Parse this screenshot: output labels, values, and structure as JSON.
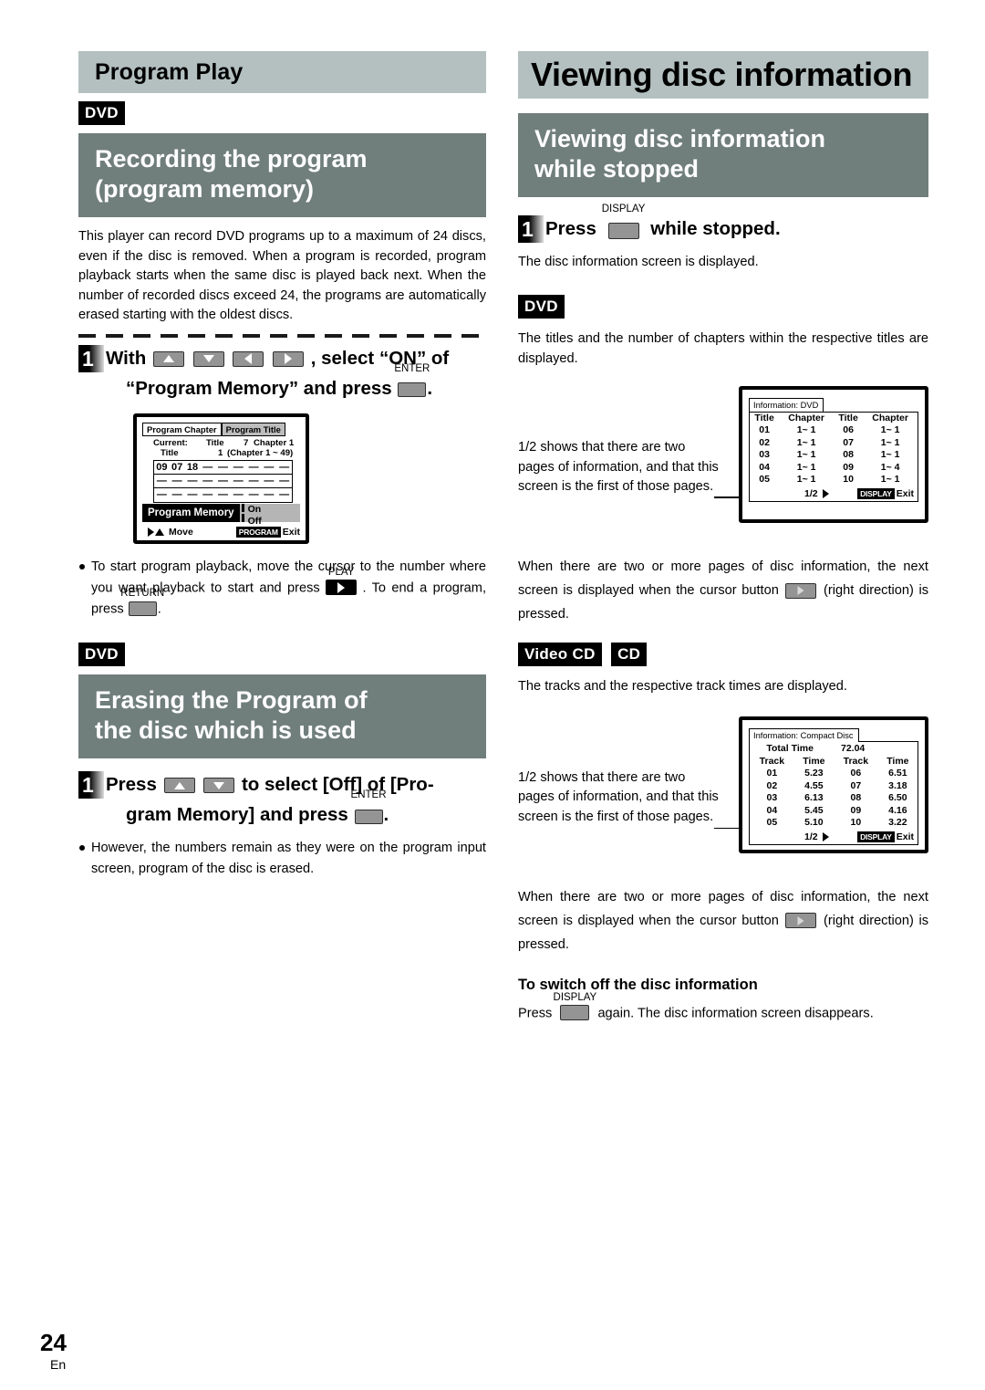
{
  "page": {
    "number": "24",
    "lang": "En"
  },
  "left": {
    "section_title": "Program Play",
    "chip_dvd_1": "DVD",
    "subhead_1_line1": "Recording the program",
    "subhead_1_line2": "(program memory)",
    "intro": "This player can record DVD programs up to a maximum of 24 discs, even if the disc is removed. When a program is recorded, program playback starts when the same disc is played back next. When the number of recorded discs exceed 24, the programs are automatically erased starting with the oldest discs.",
    "step1": {
      "num": "1",
      "t1": "With",
      "t2": ", select “ON” of",
      "t3": "“Program Memory” and press",
      "t4": ".",
      "enter_label": "ENTER"
    },
    "osd": {
      "tab_active": "Program Chapter",
      "tab_inactive": "Program Title",
      "current_label": "Current:",
      "title_label_1": "Title",
      "title_value_1": "7",
      "chapter_label": "Chapter 1",
      "title_label_2": "Title",
      "title_value_2": "1",
      "chapter_range": "(Chapter 1 ~ 49)",
      "rows": [
        [
          "09",
          "07",
          "18",
          "—",
          "—",
          "—",
          "—",
          "—",
          "—"
        ],
        [
          "—",
          "—",
          "—",
          "—",
          "—",
          "—",
          "—",
          "—",
          "—"
        ],
        [
          "—",
          "—",
          "—",
          "—",
          "—",
          "—",
          "—",
          "—",
          "—"
        ]
      ],
      "pm_label": "Program Memory",
      "pm_on": "On",
      "pm_off": "Off",
      "foot_move": "Move",
      "foot_tag": "PROGRAM",
      "foot_exit": "Exit"
    },
    "bullet1_a": "To start program playback, move the cursor to the number where you want playback to start and press",
    "bullet1_play_label": "PLAY",
    "bullet1_b": ". To end a program, press",
    "bullet1_return_label": "RETURN",
    "bullet1_c": ".",
    "chip_dvd_2": "DVD",
    "subhead_2_line1": "Erasing the Program of",
    "subhead_2_line2": "the disc which is used",
    "step2": {
      "num": "1",
      "t1": "Press",
      "t2": "to  select [Off] of [Pro-",
      "t3": "gram Memory] and press",
      "t4": ".",
      "enter_label": "ENTER"
    },
    "bullet2": "However, the numbers remain as they were on the program input screen, program of the disc is erased."
  },
  "right": {
    "page_title": "Viewing disc information",
    "subhead_line1": "Viewing disc information",
    "subhead_line2": "while stopped",
    "step1": {
      "num": "1",
      "t1": "Press",
      "t2": "while stopped.",
      "display_label": "DISPLAY"
    },
    "note1": "The disc information screen is displayed.",
    "chip_dvd": "DVD",
    "para_dvd": "The titles and the number of chapters within the respective titles are displayed.",
    "leader_note_1": "1/2 shows that there are two pages of information, and that this screen is the first of those pages.",
    "dvd_info": {
      "header": "Information: DVD",
      "cols": [
        "Title",
        "Chapter",
        "Title",
        "Chapter"
      ],
      "rows": [
        [
          "01",
          "1~ 1",
          "06",
          "1~ 1"
        ],
        [
          "02",
          "1~ 1",
          "07",
          "1~ 1"
        ],
        [
          "03",
          "1~ 1",
          "08",
          "1~ 1"
        ],
        [
          "04",
          "1~ 1",
          "09",
          "1~ 4"
        ],
        [
          "05",
          "1~ 1",
          "10",
          "1~ 1"
        ]
      ],
      "page_indicator": "1/2",
      "exit_tag": "DISPLAY",
      "exit_label": "Exit"
    },
    "para_next_1": "When there are two or more pages of disc information, the next screen is displayed when the cursor button",
    "para_next_1b": "(right direction) is pressed.",
    "chip_videocd": "Video CD",
    "chip_cd": "CD",
    "para_cd": "The tracks and the respective track times are displayed.",
    "leader_note_2": "1/2 shows that there are two pages of information, and that this screen is the first of those pages.",
    "cd_info": {
      "header": "Information: Compact Disc",
      "total_label": "Total Time",
      "total_value": "72.04",
      "cols": [
        "Track",
        "Time",
        "Track",
        "Time"
      ],
      "rows": [
        [
          "01",
          "5.23",
          "06",
          "6.51"
        ],
        [
          "02",
          "4.55",
          "07",
          "3.18"
        ],
        [
          "03",
          "6.13",
          "08",
          "6.50"
        ],
        [
          "04",
          "5.45",
          "09",
          "4.16"
        ],
        [
          "05",
          "5.10",
          "10",
          "3.22"
        ]
      ],
      "page_indicator": "1/2",
      "exit_tag": "DISPLAY",
      "exit_label": "Exit"
    },
    "para_next_2": "When there are two or more pages of disc information, the next screen is displayed when the cursor button",
    "para_next_2b": "(right direction)  is pressed.",
    "switch_off_head": "To switch off the disc information",
    "switch_off_a": "Press",
    "switch_off_display_label": "DISPLAY",
    "switch_off_b": "again. The disc information screen disappears."
  }
}
